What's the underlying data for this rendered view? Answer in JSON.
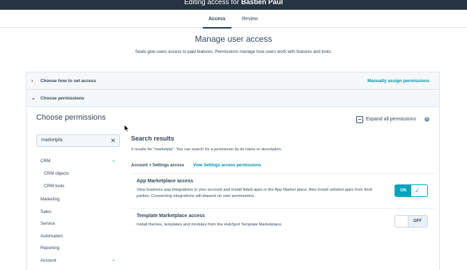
{
  "window": {
    "title_prefix": "Editing access for ",
    "title_user": "Bastien Paul"
  },
  "tabs": [
    {
      "label": "Access",
      "active": true
    },
    {
      "label": "Review",
      "active": false
    }
  ],
  "header": {
    "title": "Manage user access",
    "subtitle": "Seats give users access to paid features. Permissions manage how users work with features and tools."
  },
  "accordion": {
    "set_access": {
      "label": "Choose how to set access",
      "link": "Manually assign permissions",
      "icon": "chevron-right-icon"
    },
    "permissions": {
      "label": "Choose permissions",
      "icon": "chevron-down-icon"
    }
  },
  "permissions": {
    "title": "Choose permissions",
    "expand_label": "Expand all permissions",
    "info_icon": "info-icon",
    "search": {
      "value": "marketpla",
      "clear_icon": "close-icon"
    },
    "nav": [
      {
        "label": "CRM",
        "expandable": true
      },
      {
        "label": "CRM objects",
        "sub": true
      },
      {
        "label": "CRM tools",
        "sub": true
      },
      {
        "label": "Marketing"
      },
      {
        "label": "Sales"
      },
      {
        "label": "Service"
      },
      {
        "label": "Automation"
      },
      {
        "label": "Reporting"
      },
      {
        "label": "Account",
        "expandable": true
      }
    ]
  },
  "results": {
    "title": "Search results",
    "count_text": "2 results for \"marketpla\". You can search for a permission by its name or description.",
    "breadcrumb": "Account > Settings access",
    "breadcrumb_link": "View Settings access permissions",
    "items": [
      {
        "title": "App Marketplace access",
        "description": "View business app integrations in your account and install listed apps in the App Market place. Also install unlisted apps from third parties. Connecting integrations will depend on user permissions.",
        "toggle_label": "ON",
        "enabled": true
      },
      {
        "title": "Template Marketplace access",
        "description": "Install themes, templates and modules from the HubSpot Template Marketplace.",
        "toggle_label": "OFF",
        "enabled": false
      }
    ]
  },
  "colors": {
    "topbar": "#253342",
    "accent": "#00a4bd",
    "link": "#0091ae",
    "text": "#33475b"
  }
}
